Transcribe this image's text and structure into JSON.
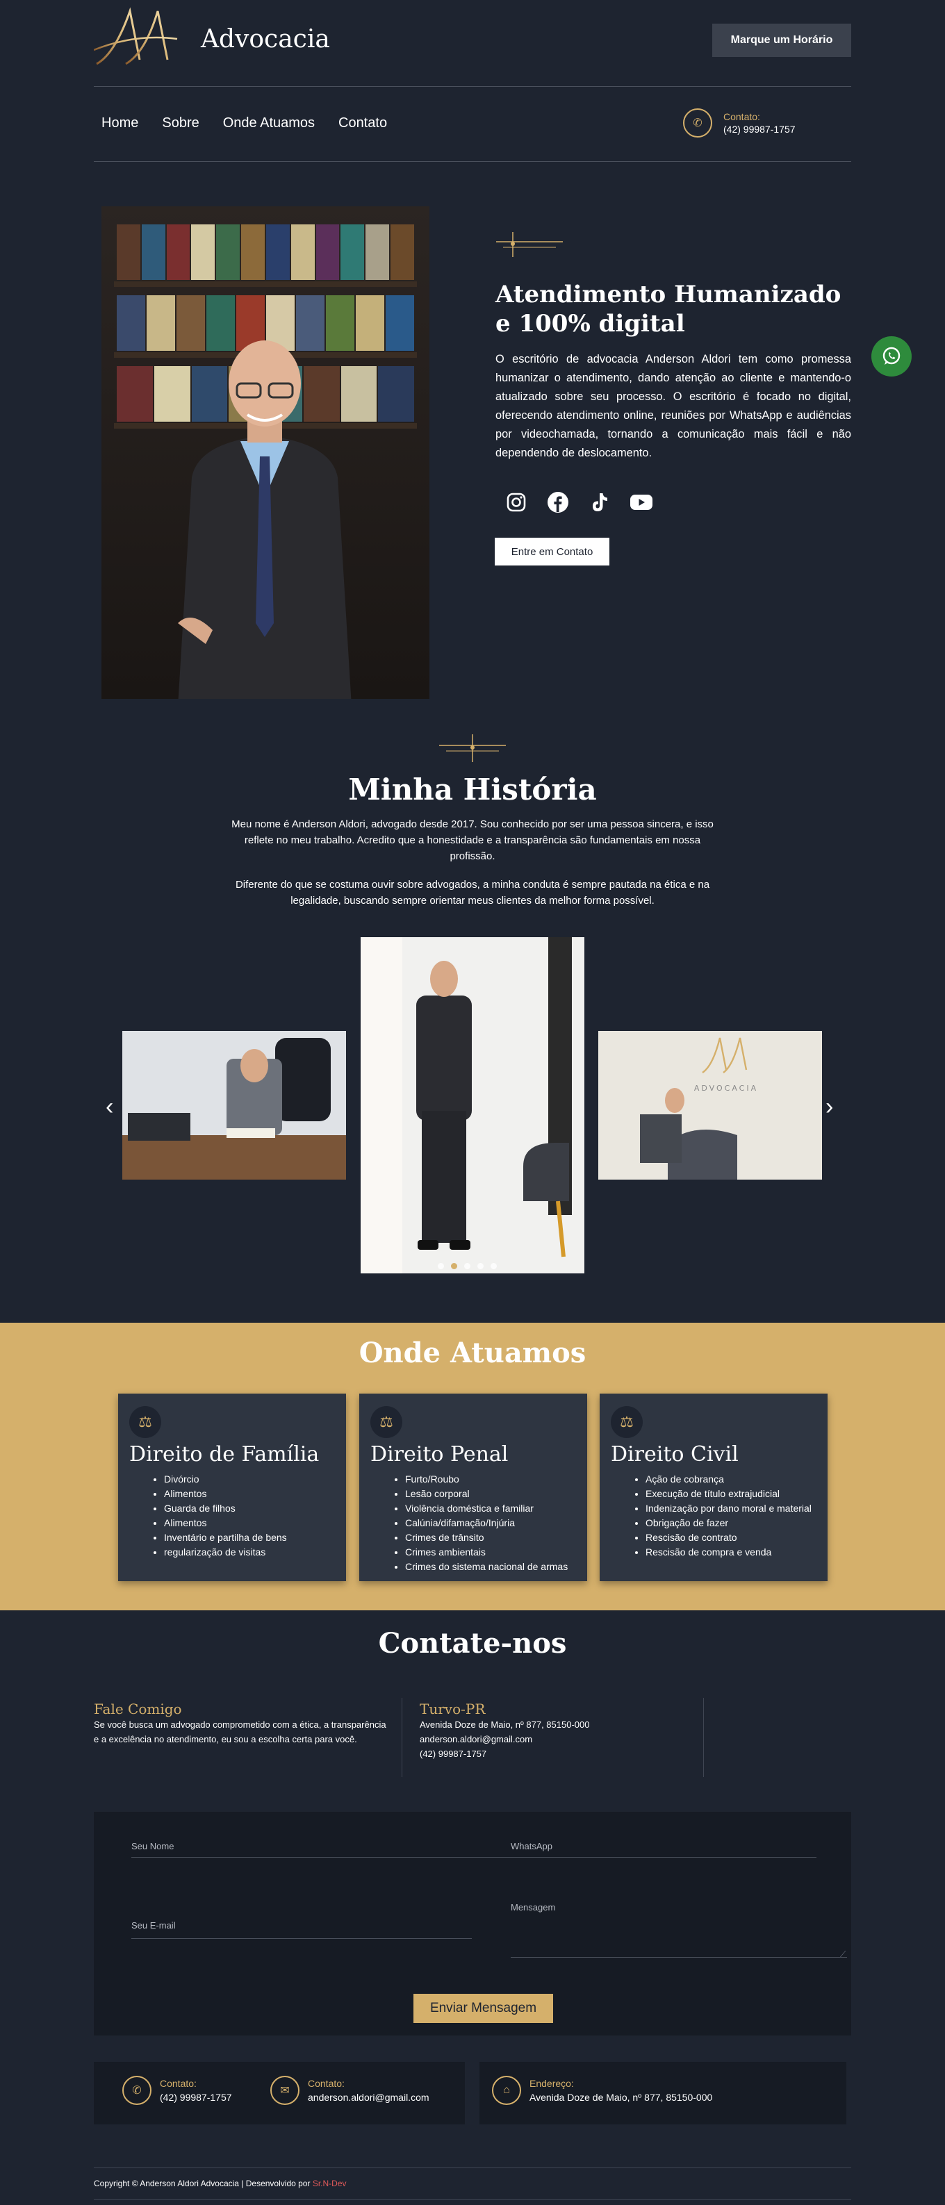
{
  "header": {
    "brand": "Advocacia",
    "book_button": "Marque um Horário",
    "nav": [
      "Home",
      "Sobre",
      "Onde Atuamos",
      "Contato"
    ],
    "contact_label": "Contato:",
    "contact_phone": "(42) 99987-1757"
  },
  "hero": {
    "title": "Atendimento Humanizado e 100% digital",
    "text": "O escritório de advocacia Anderson Aldori tem como promessa humanizar o atendimento, dando atenção ao cliente e mantendo-o atualizado sobre seu processo. O escritório é focado no digital, oferecendo atendimento online, reuniões por WhatsApp e audiências por videochamada, tornando a comunicação mais fácil e não dependendo de deslocamento.",
    "socials": [
      "instagram-icon",
      "facebook-icon",
      "tiktok-icon",
      "youtube-icon"
    ],
    "cta": "Entre em Contato"
  },
  "history": {
    "title": "Minha História",
    "p1": "Meu nome é Anderson Aldori, advogado desde 2017. Sou conhecido por ser uma pessoa sincera, e isso reflete no meu trabalho. Acredito que a honestidade e a transparência são fundamentais em nossa profissão.",
    "p2": "Diferente do que se costuma ouvir sobre advogados, a minha conduta é sempre pautada na ética e na legalidade, buscando sempre orientar meus clientes da melhor forma possível.",
    "slide_logo_text": "ADVOCACIA"
  },
  "where": {
    "title": "Onde Atuamos",
    "cards": [
      {
        "title": "Direito de Família",
        "items": [
          "Divórcio",
          "Alimentos",
          "Guarda de filhos",
          "Alimentos",
          "Inventário e partilha de bens",
          "regularização de visitas"
        ]
      },
      {
        "title": "Direito Penal",
        "items": [
          "Furto/Roubo",
          "Lesão corporal",
          "Violência doméstica e familiar",
          "Calúnia/difamação/Injúria",
          "Crimes de trânsito",
          "Crimes ambientais",
          "Crimes do sistema nacional de armas"
        ]
      },
      {
        "title": "Direito Civil",
        "items": [
          "Ação de cobrança",
          "Execução de título extrajudicial",
          "Indenização por dano moral e material",
          "Obrigação de fazer",
          "Rescisão de contrato",
          "Rescisão de compra e venda"
        ]
      }
    ]
  },
  "contact": {
    "title": "Contate-nos",
    "col1_title": "Fale Comigo",
    "col1_text": "Se você busca um advogado comprometido com a ética, a transparência e a excelência no atendimento, eu sou a escolha certa para você.",
    "col2_title": "Turvo-PR",
    "col2_lines": [
      "Avenida Doze de Maio, nº 877, 85150-000",
      "anderson.aldori@gmail.com",
      "(42) 99987-1757"
    ],
    "form": {
      "name": "Seu Nome",
      "whatsapp": "WhatsApp",
      "email": "Seu E-mail",
      "message": "Mensagem",
      "send": "Enviar Mensagem"
    }
  },
  "footer_info": [
    {
      "label": "Contato:",
      "value": "(42) 99987-1757"
    },
    {
      "label": "Contato:",
      "value": "anderson.aldori@gmail.com"
    },
    {
      "label": "Endereço:",
      "value": "Avenida Doze de Maio, nº 877, 85150-000"
    }
  ],
  "copyright": {
    "text": "Copyright © Anderson Aldori Advocacia | Desenvolvido por ",
    "dev": "Sr.N-Dev"
  },
  "colors": {
    "background": "#1e2430",
    "accent": "#d5b06b",
    "card": "#2e3541",
    "whatsapp": "#2e8b3c"
  }
}
